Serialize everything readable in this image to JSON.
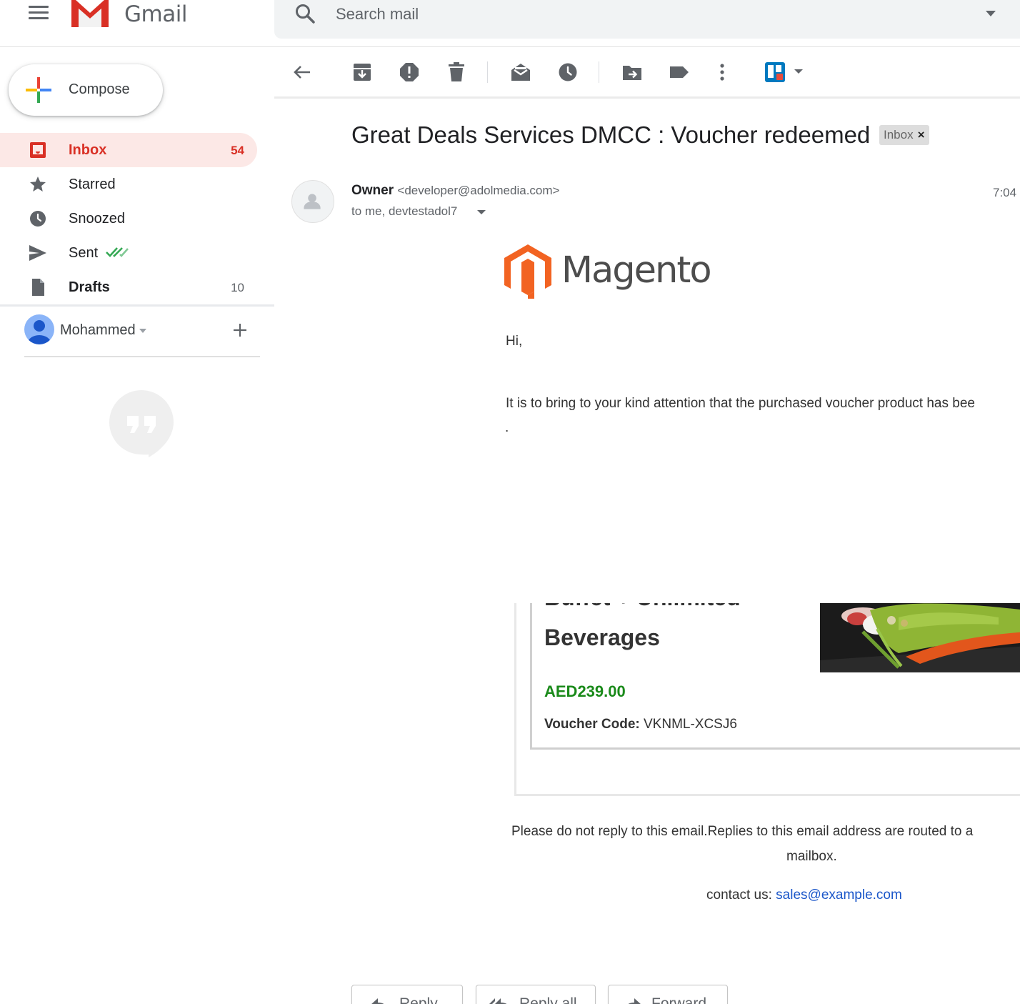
{
  "app": {
    "name": "Gmail"
  },
  "search": {
    "placeholder": "Search mail"
  },
  "compose": {
    "label": "Compose"
  },
  "nav": [
    {
      "label": "Inbox",
      "count": "54",
      "active": true
    },
    {
      "label": "Starred",
      "count": ""
    },
    {
      "label": "Snoozed",
      "count": ""
    },
    {
      "label": "Sent",
      "count": ""
    },
    {
      "label": "Drafts",
      "count": "10"
    }
  ],
  "account": {
    "name": "Mohammed"
  },
  "message": {
    "subject": "Great Deals Services DMCC : Voucher redeemed",
    "label_chip": "Inbox",
    "label_chip_close": "×",
    "sender_name": "Owner",
    "sender_email": "<developer@adolmedia.com>",
    "recipients": "to me, devtestadol7",
    "time": "7:04"
  },
  "email": {
    "brand": "Magento",
    "brand_mark": "®",
    "greeting": "Hi,",
    "paragraph": "It is to bring to your kind attention that the purchased voucher product has bee",
    "dot": ".",
    "product_title": "Buffet + Unlimited Beverages",
    "price": "AED239.00",
    "voucher_label": "Voucher Code:",
    "voucher_code": "VKNML-XCSJ6",
    "footer_note": "Please do not reply to this email.Replies to this email address are routed to a",
    "footer_note_cont": "mailbox.",
    "contact_label": "contact us:",
    "contact_email": "sales@example.com"
  },
  "actions": {
    "reply": "Reply",
    "reply_all": "Reply all",
    "forward": "Forward"
  },
  "colors": {
    "accent": "#d93025",
    "active_bg": "#fce8e6",
    "price": "#1a8a1a",
    "link": "#1a56c9",
    "magento_orange": "#f26322"
  }
}
